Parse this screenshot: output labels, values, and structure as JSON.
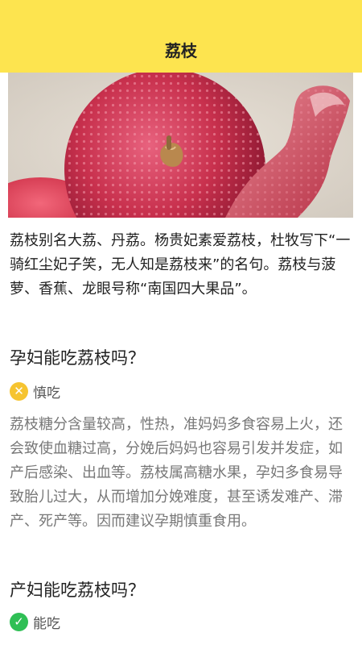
{
  "header": {
    "title": "荔枝"
  },
  "hero": {
    "alt": "荔枝图片"
  },
  "intro": {
    "text": "荔枝别名大荔、丹荔。杨贵妃素爱荔枝，杜牧写下“一骑红尘妃子笑，无人知是荔枝来”的名句。荔枝与菠萝、香蕉、龙眼号称“南国四大果品”。"
  },
  "sections": [
    {
      "title": "孕妇能吃荔枝吗？",
      "verdict": "慎吃",
      "verdict_icon": "warning-x-icon",
      "verdict_color": "#f6c430",
      "body": "荔枝糖分含量较高，性热，准妈妈多食容易上火，还会致使血糖过高，分娩后妈妈也容易引发并发症，如产后感染、出血等。荔枝属高糖水果，孕妇多食易导致胎儿过大，从而增加分娩难度，甚至诱发难产、滞产、死产等。因而建议孕期慎重食用。"
    },
    {
      "title": "产妇能吃荔枝吗？",
      "verdict": "能吃",
      "verdict_icon": "check-icon",
      "verdict_color": "#2fbf55"
    }
  ],
  "colors": {
    "header_bg": "#fde44f"
  }
}
